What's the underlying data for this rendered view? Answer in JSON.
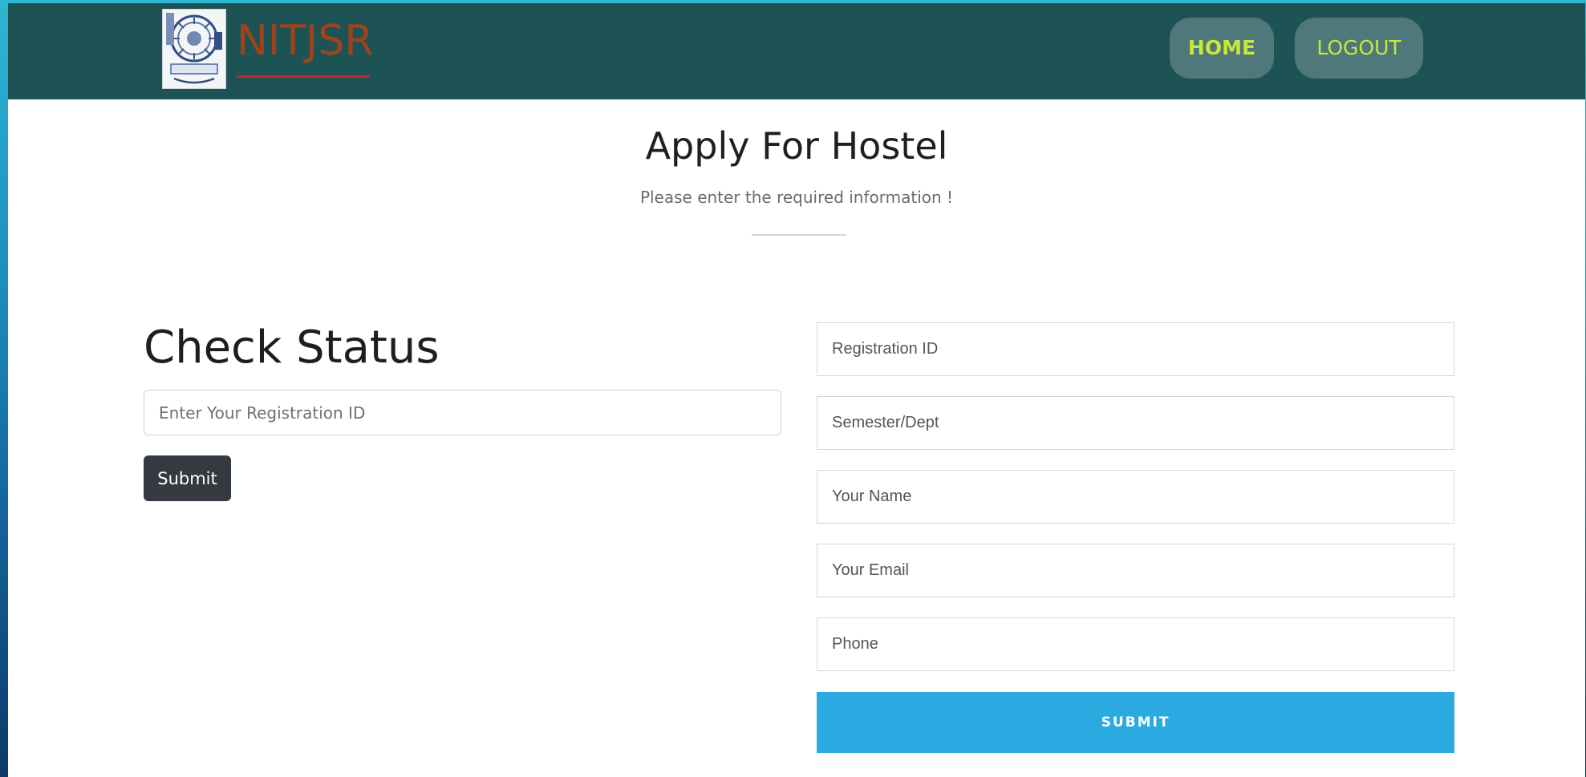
{
  "navbar": {
    "brand": "NITJSR",
    "home_label": "HOME",
    "logout_label": "LOGOUT"
  },
  "header": {
    "title": "Apply For Hostel",
    "subtitle": "Please enter the required information !"
  },
  "check_status": {
    "title": "Check Status",
    "input_placeholder": "Enter Your Registration ID",
    "submit_label": "Submit"
  },
  "application_form": {
    "fields": [
      {
        "placeholder": "Registration ID"
      },
      {
        "placeholder": "Semester/Dept"
      },
      {
        "placeholder": "Your Name"
      },
      {
        "placeholder": "Your Email"
      },
      {
        "placeholder": "Phone"
      }
    ],
    "submit_label": "SUBMIT"
  },
  "colors": {
    "navbar_bg": "#1d5355",
    "nav_text": "#c6e83a",
    "brand_text": "#a0431a",
    "brand_underline": "#c9252c",
    "dark_button": "#353a40",
    "accent_button": "#2aaae0"
  },
  "icons": {
    "logo": "institute-emblem-icon"
  }
}
